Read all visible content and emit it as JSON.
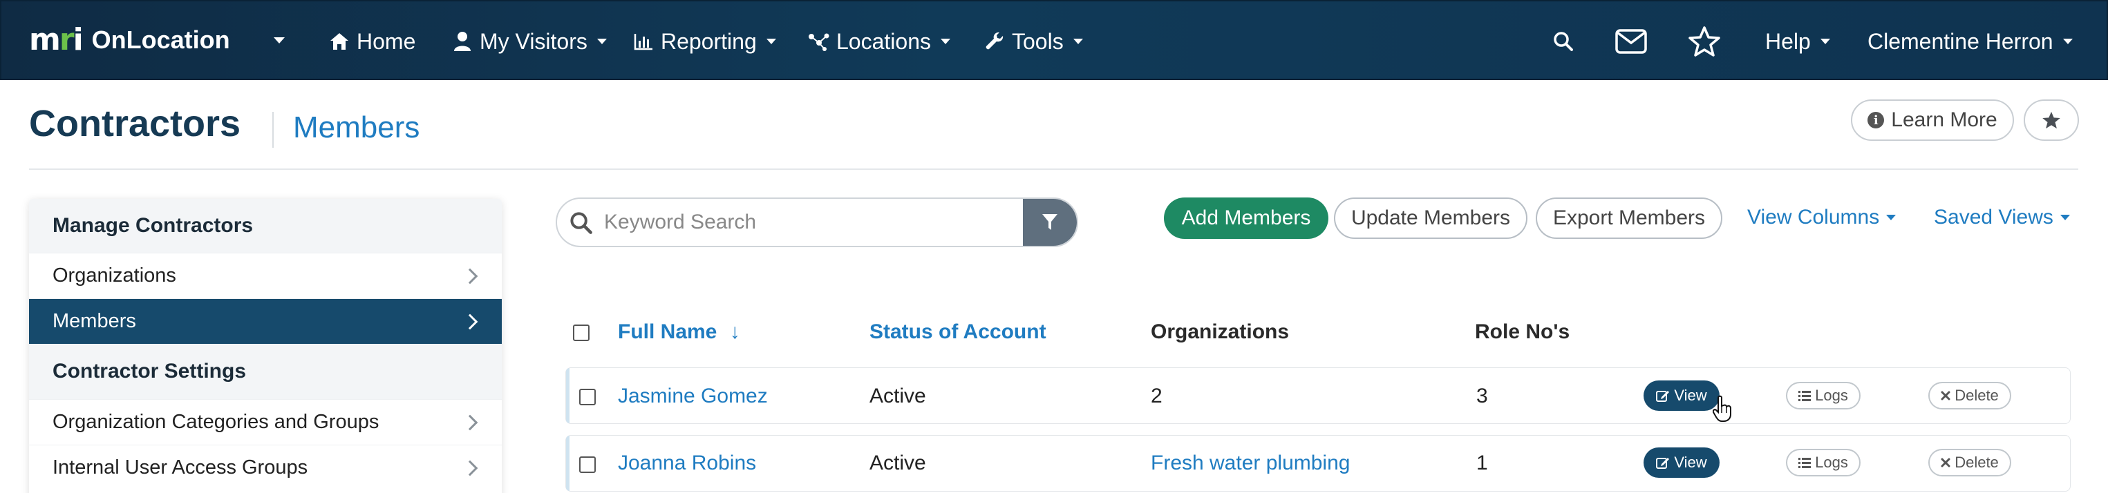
{
  "brand": {
    "logo_text": "mri",
    "app_name": "OnLocation"
  },
  "nav": {
    "items": [
      {
        "label": "Home",
        "icon": "home-icon"
      },
      {
        "label": "My Visitors",
        "icon": "user-icon"
      },
      {
        "label": "Reporting",
        "icon": "bar-chart-icon"
      },
      {
        "label": "Locations",
        "icon": "network-icon"
      },
      {
        "label": "Tools",
        "icon": "wrench-icon"
      }
    ],
    "help_label": "Help",
    "user_name": "Clementine Herron"
  },
  "page": {
    "title": "Contractors",
    "subtitle": "Members",
    "learn_more_label": "Learn More"
  },
  "sidebar": {
    "sections": [
      {
        "heading": "Manage Contractors",
        "items": [
          {
            "label": "Organizations",
            "active": false
          },
          {
            "label": "Members",
            "active": true
          }
        ]
      },
      {
        "heading": "Contractor Settings",
        "items": [
          {
            "label": "Organization Categories and Groups",
            "active": false
          },
          {
            "label": "Internal User Access Groups",
            "active": false
          }
        ]
      }
    ]
  },
  "toolbar": {
    "search_placeholder": "Keyword Search",
    "add_label": "Add Members",
    "update_label": "Update Members",
    "export_label": "Export Members",
    "view_columns_label": "View Columns",
    "saved_views_label": "Saved Views"
  },
  "table": {
    "columns": [
      "Full Name",
      "Status of Account",
      "Organizations",
      "Role No's"
    ],
    "sort_indicator": "↓",
    "rows": [
      {
        "name": "Jasmine Gomez",
        "status": "Active",
        "organizations": "2",
        "role_nos": "3"
      },
      {
        "name": "Joanna Robins",
        "status": "Active",
        "organizations": "Fresh water plumbing",
        "role_nos": "1"
      }
    ],
    "action_labels": {
      "view": "View",
      "logs": "Logs",
      "delete": "Delete"
    }
  },
  "colors": {
    "nav_bg": "#0f2b44",
    "title": "#163a54",
    "link": "#1f7cc1",
    "active_sidebar": "#164a6c",
    "primary_green": "#1e8a63"
  }
}
